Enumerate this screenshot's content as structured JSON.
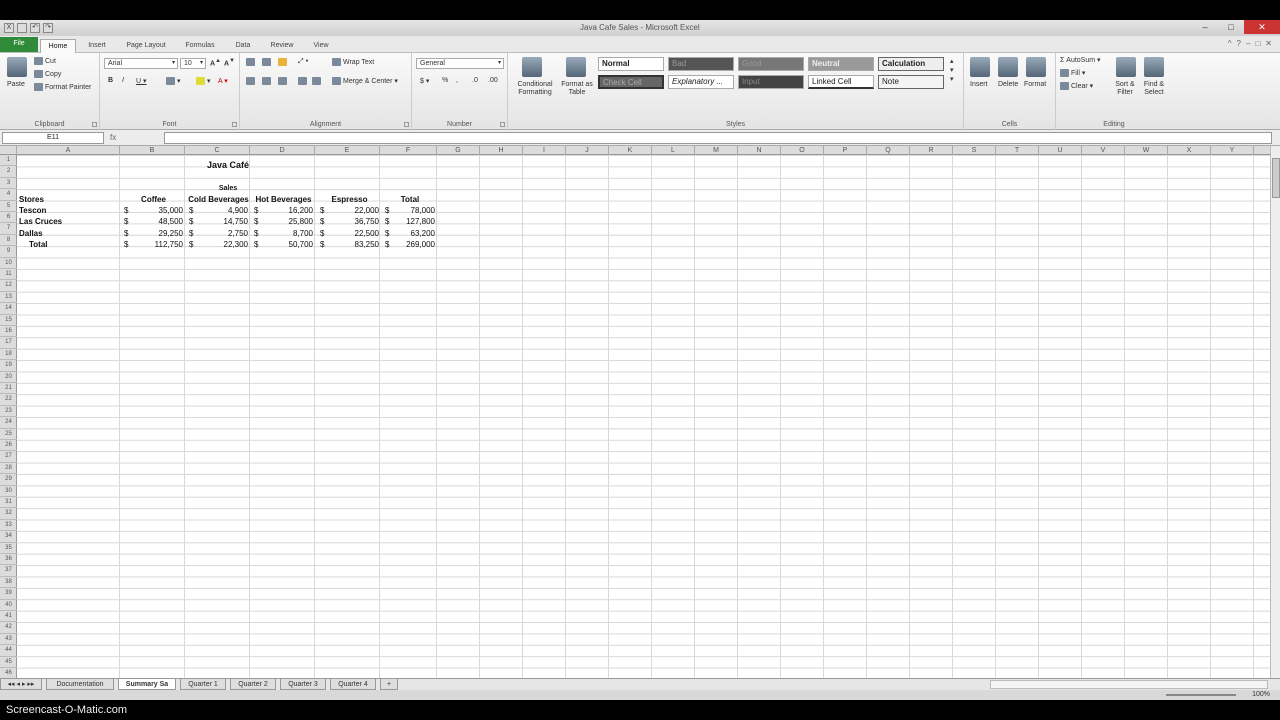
{
  "window": {
    "title": "Java Cafe Sales - Microsoft Excel"
  },
  "ribbon_tabs": [
    "File",
    "Home",
    "Insert",
    "Page Layout",
    "Formulas",
    "Data",
    "Review",
    "View"
  ],
  "clipboard": {
    "paste": "Paste",
    "cut": "Cut",
    "copy": "Copy",
    "format_painter": "Format Painter",
    "label": "Clipboard"
  },
  "font": {
    "name": "Arial",
    "size": "10",
    "label": "Font"
  },
  "alignment": {
    "wrap_text": "Wrap Text",
    "merge_center": "Merge & Center",
    "label": "Alignment"
  },
  "number": {
    "format": "General",
    "label": "Number"
  },
  "styles": {
    "conditional": "Conditional Formatting",
    "format_table": "Format as Table",
    "cells": [
      "Normal",
      "Bad",
      "Good",
      "Neutral",
      "Calculation",
      "Check Cell",
      "Explanatory ...",
      "Input",
      "Linked Cell",
      "Note"
    ],
    "label": "Styles"
  },
  "cells_group": {
    "insert": "Insert",
    "delete": "Delete",
    "format": "Format",
    "label": "Cells"
  },
  "editing": {
    "autosum": "AutoSum",
    "fill": "Fill",
    "clear": "Clear",
    "sort": "Sort & Filter",
    "find": "Find & Select",
    "label": "Editing"
  },
  "formula_bar": {
    "name_box": "E11",
    "fx": "fx",
    "value": ""
  },
  "columns": [
    "A",
    "B",
    "C",
    "D",
    "E",
    "F",
    "G",
    "H",
    "I",
    "J",
    "K",
    "L",
    "M",
    "N",
    "O",
    "P",
    "Q",
    "R",
    "S",
    "T",
    "U",
    "V",
    "W",
    "X",
    "Y",
    "Z",
    "AA",
    "AB",
    "AC",
    "AD"
  ],
  "sheet": {
    "title": "Java Café",
    "subtitle": "Sales",
    "headers": [
      "Stores",
      "Coffee",
      "Cold Beverages",
      "Hot Beverages",
      "Espresso",
      "Total"
    ],
    "rows": [
      {
        "store": "Tescon",
        "values": [
          "35,000",
          "4,900",
          "16,200",
          "22,000",
          "78,000"
        ]
      },
      {
        "store": "Las Cruces",
        "values": [
          "48,500",
          "14,750",
          "25,800",
          "36,750",
          "127,800"
        ]
      },
      {
        "store": "Dallas",
        "values": [
          "29,250",
          "2,750",
          "8,700",
          "22,500",
          "63,200"
        ]
      }
    ],
    "total": {
      "store": "Total",
      "values": [
        "112,750",
        "22,300",
        "50,700",
        "83,250",
        "269,000"
      ]
    },
    "currency": "$"
  },
  "sheet_tabs": [
    "Documentation",
    "Summary Sa",
    "Quarter 1",
    "Quarter 2",
    "Quarter 3",
    "Quarter 4"
  ],
  "status": {
    "zoom": "100%"
  },
  "watermark": "Screencast-O-Matic.com"
}
